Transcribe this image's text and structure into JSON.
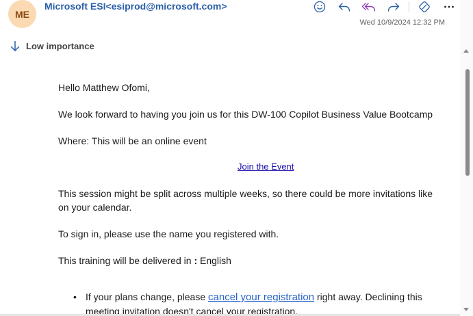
{
  "header": {
    "avatar_initials": "ME",
    "sender_name": "Microsoft ESI",
    "sender_email": "<esiprod@microsoft.com>",
    "datetime": "Wed 10/9/2024 12:32 PM",
    "actions": [
      {
        "name": "emoji-react",
        "icon": "smile-icon"
      },
      {
        "name": "reply",
        "icon": "reply-icon"
      },
      {
        "name": "reply-all",
        "icon": "reply-all-icon"
      },
      {
        "name": "forward",
        "icon": "forward-icon"
      },
      {
        "name": "loop",
        "icon": "loop-icon"
      },
      {
        "name": "more",
        "icon": "more-icon"
      }
    ],
    "importance_label": "Low importance"
  },
  "body": {
    "greeting": "Hello Matthew Ofomi,",
    "intro": "We look forward to having you join us for this DW-100 Copilot Business Value Bootcamp",
    "where": "Where: This will be an online event",
    "join_link": "Join the Event",
    "session_note_line1": "This session might be split across multiple weeks, so there could be more invitations like",
    "session_note_line2": "on your calendar.",
    "sign_in": "To sign in, please use the name you registered with.",
    "delivery_prefix": "This training will be delivered in",
    "delivery_colon": ":",
    "delivery_language": "English",
    "bullet_prefix": "If your plans change, please",
    "bullet_link": "cancel your registration",
    "bullet_suffix": "right away. Declining this",
    "bullet_line2": "meeting invitation doesn't cancel your registration."
  },
  "colors": {
    "sender": "#2b5fa8",
    "avatar_bg": "#fbd9b3",
    "avatar_fg": "#8a4a12",
    "icon_accent": "#2b5fa8",
    "reply_all_purple": "#8f3fb8"
  }
}
